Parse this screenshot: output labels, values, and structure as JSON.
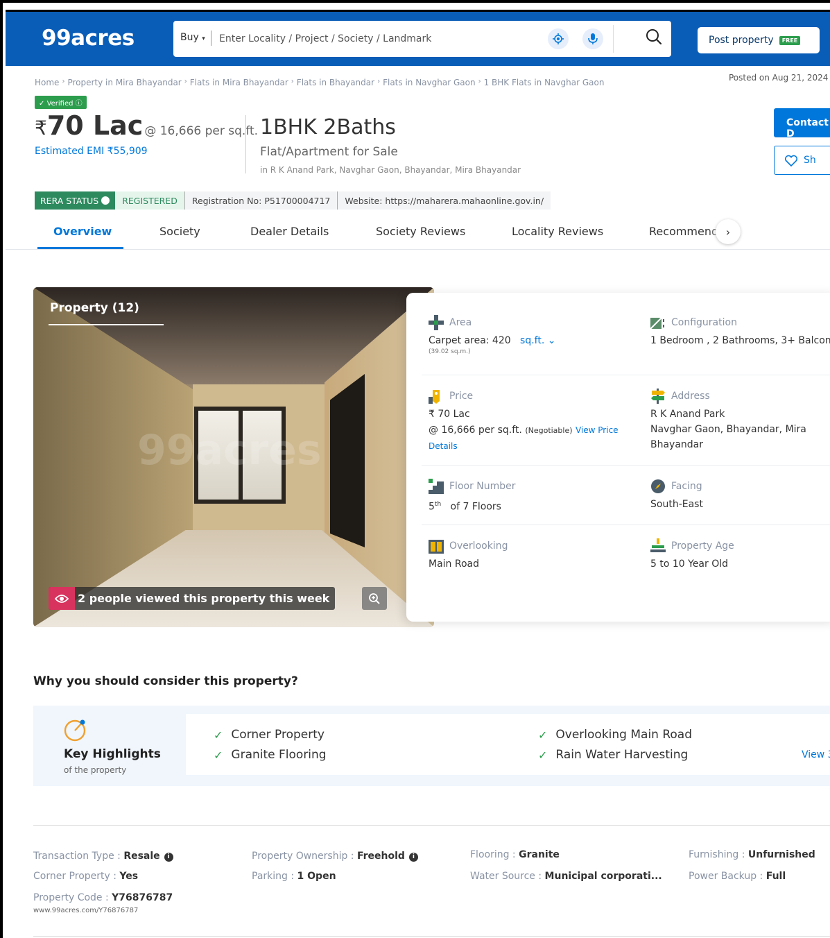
{
  "header": {
    "logo": "99acres",
    "buy_label": "Buy",
    "search_placeholder": "Enter Locality / Project / Society / Landmark",
    "post_property": "Post property",
    "free_badge": "FREE"
  },
  "breadcrumb": [
    "Home",
    "Property in Mira Bhayandar",
    "Flats in Mira Bhayandar",
    "Flats in Bhayandar",
    "Flats in Navghar Gaon",
    "1 BHK Flats in Navghar Gaon"
  ],
  "posted": "Posted on Aug 21, 2024",
  "verified": "Verified",
  "price": {
    "rupee": "₹",
    "amount": "70 Lac",
    "per_sqft": "@ 16,666 per sq.ft.",
    "emi": "Estimated EMI ₹55,909"
  },
  "listing": {
    "title": "1BHK 2Baths",
    "subtitle": "Flat/Apartment for Sale",
    "location": "in R K Anand Park, Navghar Gaon, Bhayandar, Mira Bhayandar"
  },
  "actions": {
    "contact": "Contact D",
    "shortlist": "Sh"
  },
  "rera": {
    "status_label": "RERA STATUS",
    "status_value": "REGISTERED",
    "registration": "Registration No: P51700004717",
    "website": "Website: https://maharera.mahaonline.gov.in/"
  },
  "tabs": [
    "Overview",
    "Society",
    "Dealer Details",
    "Society Reviews",
    "Locality Reviews",
    "Recommend"
  ],
  "gallery": {
    "title": "Property (12)",
    "views": "2 people viewed this property this week",
    "watermark": "99acres"
  },
  "details": {
    "area": {
      "label": "Area",
      "value": "Carpet area: 420",
      "unit": "sq.ft.",
      "sub": "(39.02 sq.m.)"
    },
    "configuration": {
      "label": "Configuration",
      "value": "1 Bedroom , 2 Bathrooms, 3+ Balcon"
    },
    "price": {
      "label": "Price",
      "line1": "₹ 70 Lac",
      "line2": "@ 16,666 per sq.ft.",
      "negotiable": "(Negotiable)",
      "link1": "View Price",
      "link2": "Details"
    },
    "address": {
      "label": "Address",
      "line1": "R K Anand Park",
      "line2": "Navghar Gaon, Bhayandar, Mira",
      "line3": "Bhayandar"
    },
    "floor": {
      "label": "Floor Number",
      "num": "5",
      "sup": "th",
      "rest": "of 7 Floors"
    },
    "facing": {
      "label": "Facing",
      "value": "South-East"
    },
    "overlooking": {
      "label": "Overlooking",
      "value": "Main Road"
    },
    "age": {
      "label": "Property Age",
      "value": "5 to 10 Year Old"
    }
  },
  "why": {
    "title": "Why you should consider this property?",
    "kh_title": "Key Highlights",
    "kh_sub": "of the property",
    "highlights": [
      "Corner Property",
      "Granite Flooring",
      "Overlooking Main Road",
      "Rain Water Harvesting"
    ],
    "view_more": "View 3"
  },
  "attributes": {
    "transaction": {
      "k": "Transaction Type : ",
      "v": "Resale"
    },
    "corner": {
      "k": "Corner Property : ",
      "v": "Yes"
    },
    "code": {
      "k": "Property Code : ",
      "v": "Y76876787"
    },
    "code_url": "www.99acres.com/Y76876787",
    "ownership": {
      "k": "Property Ownership : ",
      "v": "Freehold"
    },
    "parking": {
      "k": "Parking : ",
      "v": "1 Open"
    },
    "flooring": {
      "k": "Flooring : ",
      "v": "Granite"
    },
    "water": {
      "k": "Water Source : ",
      "v": "Municipal corporati..."
    },
    "furnishing": {
      "k": "Furnishing : ",
      "v": "Unfurnished"
    },
    "power": {
      "k": "Power Backup : ",
      "v": "Full"
    }
  },
  "colors": {
    "brand": "#0a5db7",
    "accent": "#0078db",
    "green": "#2c9d4d"
  }
}
